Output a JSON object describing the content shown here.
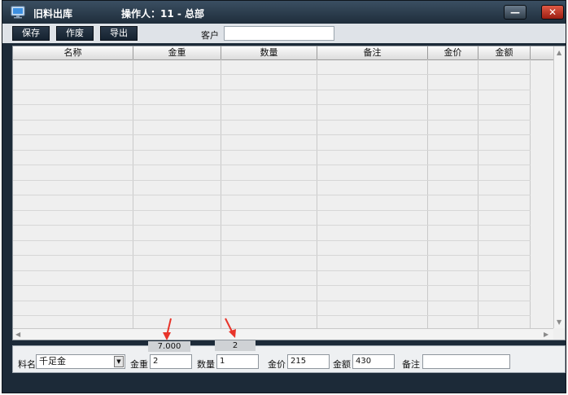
{
  "window": {
    "title": "旧料出库",
    "operator": "操作人：11 - 总部",
    "minimize_label": "—",
    "close_label": "✕",
    "app_icon": "monitor-icon"
  },
  "toolbar": {
    "save_label": "保存",
    "void_label": "作废",
    "export_label": "导出",
    "customer_label": "客户",
    "customer_value": ""
  },
  "grid": {
    "columns": [
      "名称",
      "金重",
      "数量",
      "备注",
      "金价",
      "金额"
    ],
    "rows": []
  },
  "entry": {
    "material_label": "料名",
    "material_value": "千足金",
    "gold_weight_label": "金重",
    "gold_weight_value": "2",
    "quantity_label": "数量",
    "quantity_value": "1",
    "gold_price_label": "金价",
    "gold_price_value": "215",
    "amount_label": "金额",
    "amount_value": "430",
    "remark_label": "备注",
    "remark_value": ""
  },
  "annotations": {
    "weight_callout": "7.000",
    "quantity_callout": "2",
    "arrow_color": "#e8342a"
  }
}
